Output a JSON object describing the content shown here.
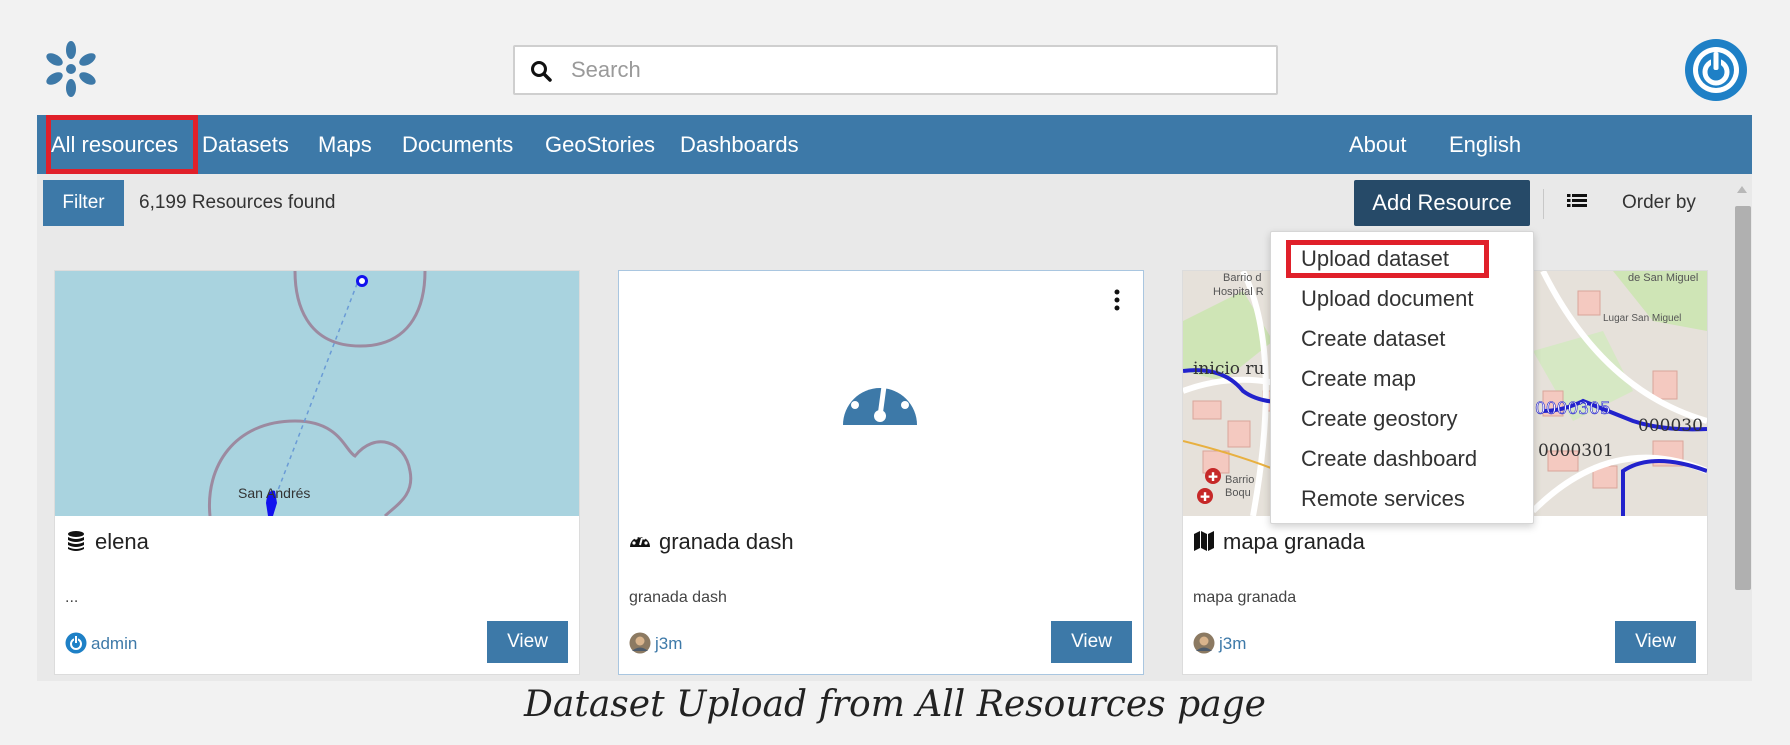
{
  "header": {
    "logo_icon": "geonode-flower-icon",
    "search_placeholder": "Search",
    "user_icon": "power-icon"
  },
  "nav": {
    "left": [
      "All resources",
      "Datasets",
      "Maps",
      "Documents",
      "GeoStories",
      "Dashboards"
    ],
    "right": [
      "About",
      "English"
    ],
    "active": "All resources"
  },
  "toolbar": {
    "filter_label": "Filter",
    "resource_count": "6,199 Resources found",
    "add_resource_label": "Add Resource",
    "order_label": "Order by"
  },
  "add_menu": {
    "items": [
      "Upload dataset",
      "Upload document",
      "Create dataset",
      "Create map",
      "Create geostory",
      "Create dashboard",
      "Remote services"
    ],
    "highlighted": "Upload dataset"
  },
  "cards": [
    {
      "title": "elena",
      "type_icon": "database-icon",
      "description": "...",
      "owner": "admin",
      "owner_icon": "power-icon",
      "view_label": "View",
      "map_label": "San Andrés"
    },
    {
      "title": "granada dash",
      "type_icon": "dashboard-icon",
      "description": "granada dash",
      "owner": "j3m",
      "owner_icon": "avatar",
      "view_label": "View"
    },
    {
      "title": "mapa granada",
      "type_icon": "map-icon",
      "description": "mapa granada",
      "owner": "j3m",
      "owner_icon": "avatar",
      "view_label": "View"
    }
  ],
  "map3_labels": {
    "a": "Barrio d",
    "b": "Hospital R",
    "c": "inicio ru",
    "d": "de San Miguel",
    "e": "0000305",
    "f": "000030",
    "g": "0000301",
    "h": "Barrio",
    "i": "Boqu",
    "j": "Lugar San Miguel"
  },
  "colors": {
    "primary": "#3d79a8",
    "primary_dark": "#264a68",
    "highlight": "#e0202a"
  },
  "caption": "Dataset Upload from All Resources page"
}
